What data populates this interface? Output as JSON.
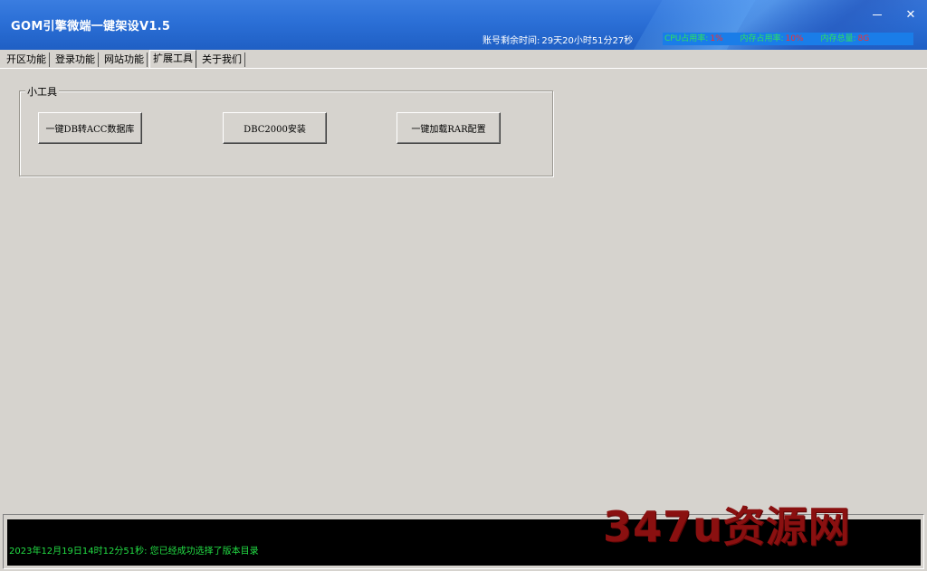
{
  "window": {
    "title": "GOM引擎微端一键架设V1.5",
    "minimize_glyph": "—",
    "close_glyph": "✕"
  },
  "status": {
    "remaining_label": "账号剩余时间:",
    "remaining_value": "29天20小时51分27秒",
    "cpu_label": "CPU占用率:",
    "cpu_value": "1%",
    "mem_label": "内存占用率:",
    "mem_value": "10%",
    "total_label": "内存总量:",
    "total_value": "8G"
  },
  "tabs": [
    {
      "label": "开区功能"
    },
    {
      "label": "登录功能"
    },
    {
      "label": "网站功能"
    },
    {
      "label": "扩展工具"
    },
    {
      "label": "关于我们"
    }
  ],
  "groupbox": {
    "title": "小工具",
    "buttons": [
      {
        "label": "一键DB转ACC数据库"
      },
      {
        "label": "DBC2000安装"
      },
      {
        "label": "一键加载RAR配置"
      }
    ]
  },
  "log": {
    "line": "2023年12月19日14时12分51秒: 您已经成功选择了版本目录"
  },
  "watermark": {
    "text": "347u资源网"
  },
  "colors": {
    "titlebar": "#2b6fd6",
    "stats_bg": "#1a7de8",
    "stats_label": "#2fe35a",
    "stats_value": "#ff2a2a",
    "log_text": "#22dd44",
    "watermark": "#8a1010"
  }
}
